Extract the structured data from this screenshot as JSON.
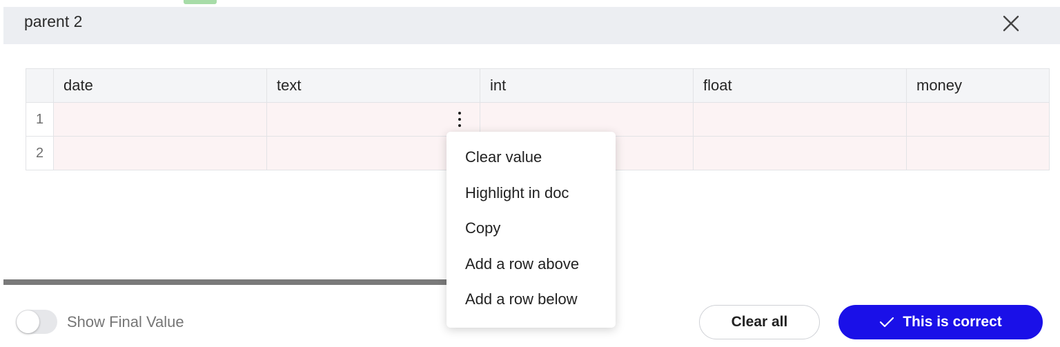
{
  "panel": {
    "title": "parent 2",
    "close_icon": "close-icon"
  },
  "table": {
    "columns": [
      "date",
      "text",
      "int",
      "float",
      "money"
    ],
    "rows": [
      {
        "num": "1",
        "cells": [
          "",
          "",
          "",
          "",
          ""
        ]
      },
      {
        "num": "2",
        "cells": [
          "",
          "",
          "",
          "",
          ""
        ]
      }
    ]
  },
  "context_menu": {
    "items": [
      "Clear value",
      "Highlight in doc",
      "Copy",
      "Add a row above",
      "Add a row below"
    ]
  },
  "footer": {
    "toggle_label": "Show Final Value",
    "toggle_on": false,
    "clear_all_label": "Clear all",
    "confirm_label": "This is correct",
    "confirm_icon": "check-icon"
  },
  "colors": {
    "accent": "#1a10e8",
    "header_bg": "#eceef2",
    "cell_bg": "#fcf3f4"
  }
}
